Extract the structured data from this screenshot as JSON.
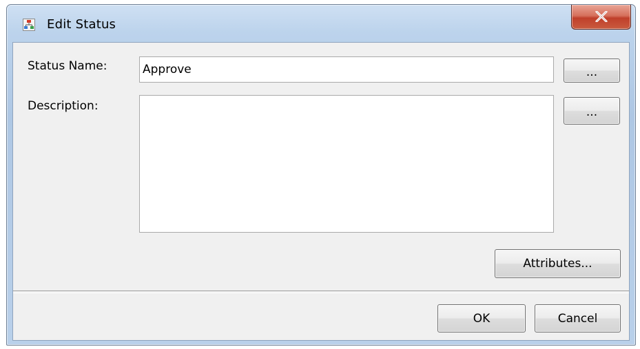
{
  "window": {
    "title": "Edit Status",
    "icon": "workflow-app-icon",
    "close_icon": "close-x-icon"
  },
  "form": {
    "status_name_label": "Status Name:",
    "status_name_value": "Approve",
    "status_name_browse": "...",
    "description_label": "Description:",
    "description_value": "",
    "description_browse": "...",
    "attributes_button": "Attributes..."
  },
  "footer": {
    "ok_label": "OK",
    "cancel_label": "Cancel"
  }
}
